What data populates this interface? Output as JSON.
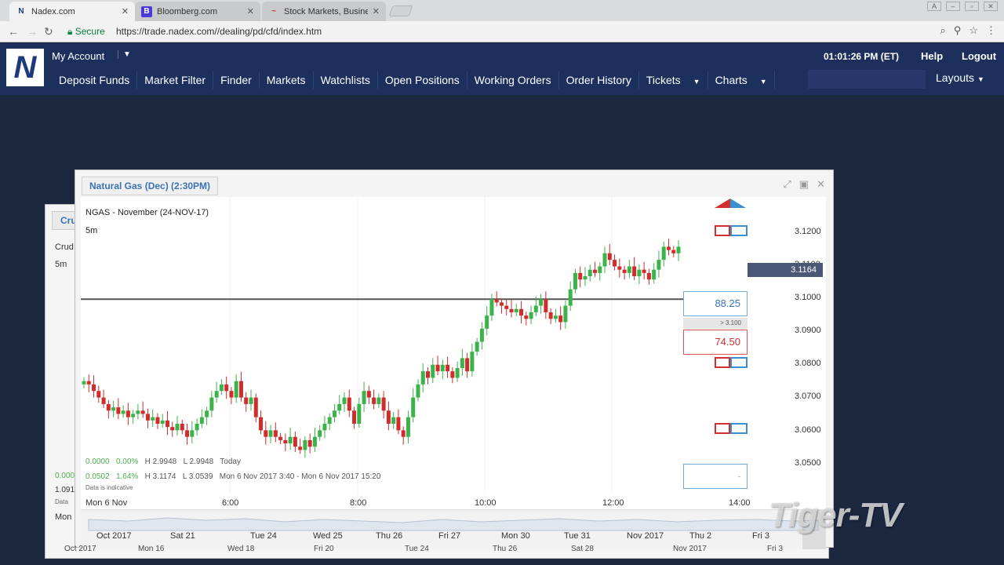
{
  "browser": {
    "tabs": [
      {
        "label": "Nadex.com",
        "favicon": "N",
        "active": true
      },
      {
        "label": "Bloomberg.com",
        "favicon": "B",
        "active": false
      },
      {
        "label": "Stock Markets, Business",
        "favicon": "~",
        "active": false
      }
    ],
    "secure_label": "Secure",
    "url": "https://trade.nadex.com//dealing/pd/cfd/index.htm"
  },
  "header": {
    "logo_letter": "N",
    "my_account": "My Account",
    "clock": "01:01:26 PM (ET)",
    "help": "Help",
    "logout": "Logout",
    "layouts": "Layouts",
    "menu": [
      "Deposit Funds",
      "Market Filter",
      "Finder",
      "Markets",
      "Watchlists",
      "Open Positions",
      "Working Orders",
      "Order History",
      "Tickets",
      "Charts"
    ]
  },
  "back_window": {
    "tab_label": "Cru",
    "symbol_partial": "Crud",
    "timeframe": "5m",
    "row_a": "0.000",
    "row_b": "1.091",
    "row_c": "Data",
    "xlabel": "Mon"
  },
  "chart_window": {
    "title": "Natural Gas (Dec) (2:30PM)",
    "symbol": "NGAS - November (24-NOV-17)",
    "timeframe": "5m",
    "bid": "88.25",
    "ask": "74.50",
    "strike_label": "> 3.100",
    "current_price": "3.1164",
    "ohlc_row1": {
      "chg": "0.0000",
      "pct": "0.00%",
      "high": "H 2.9948",
      "low": "L 2.9948",
      "period": "Today"
    },
    "ohlc_row2": {
      "chg": "0.0502",
      "pct": "1.64%",
      "high": "H 3.1174",
      "low": "L 3.0539",
      "period": "Mon 6 Nov 2017 3:40 - Mon 6 Nov 2017 15:20"
    },
    "data_note": "Data is indicative",
    "x_first": "Mon 6 Nov",
    "x_ticks": [
      "6:00",
      "8:00",
      "10:00",
      "12:00",
      "14:00"
    ],
    "y_ticks": [
      "3.1200",
      "3.1100",
      "3.1000",
      "3.0900",
      "3.0800",
      "3.0700",
      "3.0600",
      "3.0500"
    ],
    "navigator_labels": [
      "Oct 2017",
      "Sat 21",
      "Tue 24",
      "Wed 25",
      "Thu 26",
      "Fri 27",
      "Mon 30",
      "Tue 31",
      "Nov 2017",
      "Thu 2",
      "Fri 3"
    ],
    "navigator_labels2": [
      "Oct 2017",
      "Mon 16",
      "Wed 18",
      "Fri 20",
      "Tue 24",
      "Thu 26",
      "Sat 28",
      "Nov 2017",
      "Fri 3"
    ]
  },
  "watermark": "Tiger-TV",
  "chart_data": {
    "type": "candlestick",
    "ylim": [
      3.045,
      3.124
    ],
    "strike": 3.1,
    "up_color": "#3cb34a",
    "down_color": "#d02c2c",
    "closes": [
      3.075,
      3.074,
      3.072,
      3.07,
      3.068,
      3.066,
      3.067,
      3.065,
      3.066,
      3.064,
      3.065,
      3.066,
      3.065,
      3.063,
      3.064,
      3.062,
      3.063,
      3.061,
      3.06,
      3.062,
      3.06,
      3.058,
      3.06,
      3.062,
      3.064,
      3.066,
      3.07,
      3.072,
      3.074,
      3.072,
      3.07,
      3.075,
      3.07,
      3.068,
      3.07,
      3.064,
      3.06,
      3.058,
      3.06,
      3.058,
      3.057,
      3.056,
      3.058,
      3.055,
      3.054,
      3.057,
      3.055,
      3.058,
      3.06,
      3.062,
      3.064,
      3.066,
      3.068,
      3.07,
      3.066,
      3.062,
      3.068,
      3.072,
      3.07,
      3.068,
      3.07,
      3.066,
      3.062,
      3.064,
      3.06,
      3.058,
      3.064,
      3.07,
      3.074,
      3.078,
      3.076,
      3.08,
      3.078,
      3.08,
      3.078,
      3.076,
      3.079,
      3.082,
      3.078,
      3.084,
      3.087,
      3.091,
      3.095,
      3.1,
      3.099,
      3.098,
      3.097,
      3.096,
      3.097,
      3.095,
      3.094,
      3.096,
      3.098,
      3.1,
      3.096,
      3.094,
      3.095,
      3.093,
      3.098,
      3.103,
      3.108,
      3.106,
      3.107,
      3.109,
      3.108,
      3.11,
      3.114,
      3.112,
      3.11,
      3.109,
      3.108,
      3.11,
      3.107,
      3.109,
      3.108,
      3.106,
      3.109,
      3.112,
      3.116,
      3.115,
      3.114,
      3.116
    ]
  }
}
